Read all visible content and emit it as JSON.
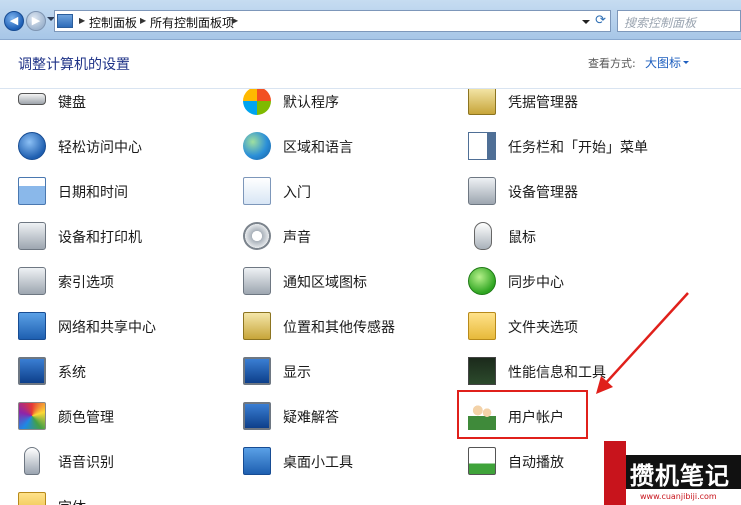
{
  "address_bar": {
    "crumbs": [
      "控制面板",
      "所有控制面板项"
    ],
    "search_placeholder": "搜索控制面板"
  },
  "header": {
    "title": "调整计算机的设置",
    "view_label": "查看方式:",
    "view_value": "大图标"
  },
  "items": {
    "keyboard": "键盘",
    "default_programs": "默认程序",
    "credential_manager": "凭据管理器",
    "ease_of_access": "轻松访问中心",
    "region_language": "区域和语言",
    "taskbar_start": "任务栏和「开始」菜单",
    "date_time": "日期和时间",
    "getting_started": "入门",
    "device_manager": "设备管理器",
    "devices_printers": "设备和打印机",
    "sound": "声音",
    "mouse": "鼠标",
    "indexing": "索引选项",
    "notification_icons": "通知区域图标",
    "sync_center": "同步中心",
    "network_sharing": "网络和共享中心",
    "location_sensors": "位置和其他传感器",
    "folder_options": "文件夹选项",
    "system": "系统",
    "display": "显示",
    "performance": "性能信息和工具",
    "color_management": "颜色管理",
    "troubleshooting": "疑难解答",
    "user_accounts": "用户帐户",
    "speech_recognition": "语音识别",
    "desktop_gadgets": "桌面小工具",
    "autoplay": "自动播放",
    "fonts": "字体"
  },
  "watermark": {
    "title": "攒机笔记",
    "url": "www.cuanjibiji.com"
  },
  "colors": {
    "title_blue": "#1e3287",
    "link_blue": "#1e5fbf",
    "highlight_red": "#e0201b"
  }
}
